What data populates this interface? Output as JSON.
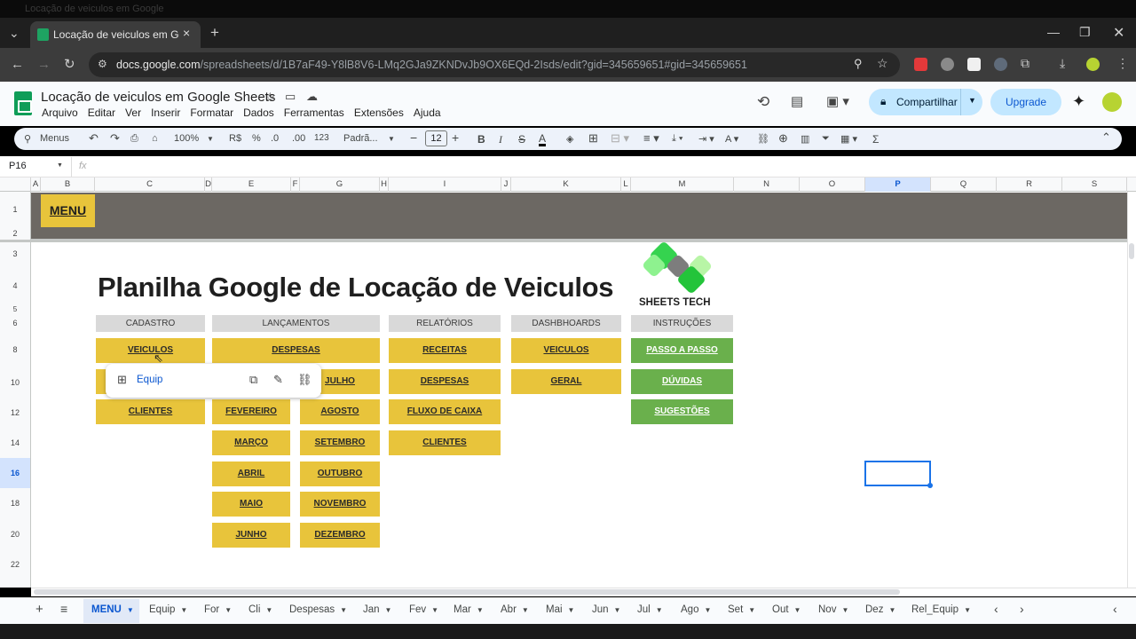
{
  "browser": {
    "tab_title": "Locação de veiculos em Google",
    "url_host": "docs.google.com",
    "url_path": "/spreadsheets/d/1B7aF49-Y8lB8V6-LMq2GJa9ZKNDvJb9OX6EQd-2Isds/edit?gid=345659651#gid=345659651",
    "ghost_text": "Locação de veiculos em Google"
  },
  "app": {
    "doc_title": "Locação de veiculos em Google Sheets",
    "menus": [
      "Arquivo",
      "Editar",
      "Ver",
      "Inserir",
      "Formatar",
      "Dados",
      "Ferramentas",
      "Extensões",
      "Ajuda"
    ],
    "share_label": "Compartilhar",
    "upgrade_label": "Upgrade"
  },
  "toolbar": {
    "search": "Menus",
    "zoom": "100%",
    "currency": "R$",
    "percent": "%",
    "dec_less": ".0",
    "dec_more": ".00",
    "num_format": "123",
    "font": "Padrã...",
    "font_size": "12",
    "bold": "B",
    "italic": "I",
    "sum": "Σ"
  },
  "formula": {
    "cell_ref": "P16",
    "fx": "fx"
  },
  "columns": [
    "A",
    "B",
    "C",
    "D",
    "E",
    "F",
    "G",
    "H",
    "I",
    "J",
    "K",
    "L",
    "M",
    "N",
    "O",
    "P",
    "Q",
    "R",
    "S"
  ],
  "rows": [
    "1",
    "2",
    "3",
    "4",
    "5",
    "6",
    "8",
    "10",
    "12",
    "14",
    "16",
    "18",
    "20",
    "22"
  ],
  "sheet": {
    "menu_label": "MENU",
    "title": "Planilha Google de Locação de Veiculos",
    "brand": "SHEETS TECH",
    "headers": {
      "cadastro": "CADASTRO",
      "lancamentos": "LANÇAMENTOS",
      "relatorios": "RELATÓRIOS",
      "dashboards": "DASHBHOARDS",
      "instrucoes": "INSTRUÇÕES"
    },
    "cadastro": [
      "VEICULOS",
      "CLIENTES"
    ],
    "lancamentos_left": [
      "DESPESAS",
      "FEVEREIRO",
      "MARÇO",
      "ABRIL",
      "MAIO",
      "JUNHO"
    ],
    "lancamentos_right": [
      "JULHO",
      "AGOSTO",
      "SETEMBRO",
      "OUTUBRO",
      "NOVEMBRO",
      "DEZEMBRO"
    ],
    "relatorios": [
      "RECEITAS",
      "DESPESAS",
      "FLUXO DE CAIXA",
      "CLIENTES"
    ],
    "dashboards": [
      "VEICULOS",
      "GERAL"
    ],
    "instrucoes": [
      "PASSO A PASSO",
      "DÚVIDAS",
      "SUGESTÕES"
    ],
    "popup_link": "Equip"
  },
  "sheet_tabs": [
    "MENU",
    "Equip",
    "For",
    "Cli",
    "Despesas",
    "Jan",
    "Fev",
    "Mar",
    "Abr",
    "Mai",
    "Jun",
    "Jul",
    "Ago",
    "Set",
    "Out",
    "Nov",
    "Dez",
    "Rel_Equip"
  ],
  "colors": {
    "yellow": "#e8c43b",
    "green": "#6ab04c",
    "band": "#6c6863",
    "accent": "#0b57d0"
  }
}
